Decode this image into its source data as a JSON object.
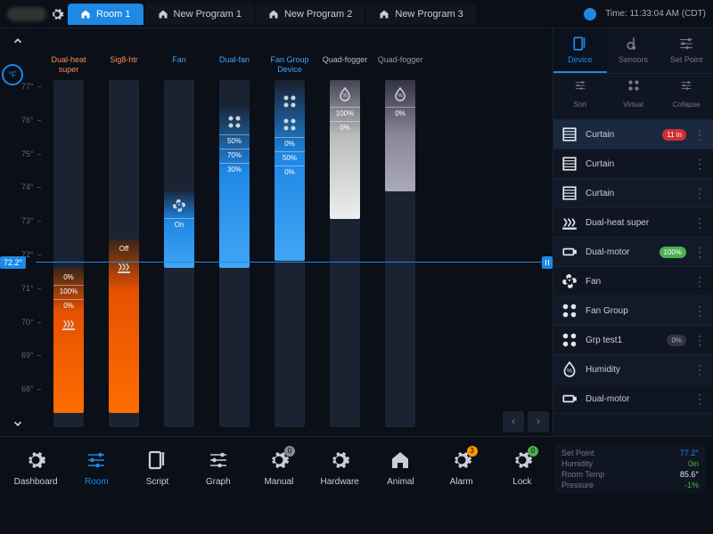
{
  "header": {
    "tabs": [
      {
        "label": "Room 1",
        "active": true
      },
      {
        "label": "New Program 1",
        "active": false
      },
      {
        "label": "New Program 2",
        "active": false
      },
      {
        "label": "New Program 3",
        "active": false
      }
    ],
    "time": "Time: 11:33:04 AM (CDT)"
  },
  "axis": {
    "unit": "°F",
    "setpoint": "72.2°",
    "ticks": [
      "77°",
      "76°",
      "75°",
      "74°",
      "73°",
      "72°",
      "71°",
      "70°",
      "69°",
      "68°"
    ]
  },
  "chart_data": {
    "type": "bar",
    "setpoint_temp": 72.2,
    "y_range": [
      67.5,
      77.5
    ],
    "columns": [
      {
        "name": "Dual-heat super",
        "group": "heat",
        "segments": [
          {
            "label": "0%"
          },
          {
            "label": "100%"
          },
          {
            "label": "0%"
          },
          {
            "icon": "heater"
          }
        ],
        "bar_top_pct": 54,
        "bar_height_pct": 42
      },
      {
        "name": "Sig8-htr",
        "group": "heat",
        "segments": [
          {
            "label": "Off"
          },
          {
            "icon": "heater"
          }
        ],
        "bar_top_pct": 46,
        "bar_height_pct": 50
      },
      {
        "name": "Fan",
        "group": "cool",
        "segments": [
          {
            "icon": "fan"
          },
          {
            "label": "On"
          }
        ],
        "bar_top_pct": 32,
        "bar_height_pct": 22
      },
      {
        "name": "Dual-fan",
        "group": "cool",
        "segments": [
          {
            "icon": "fan-group"
          },
          {
            "label": "50%"
          },
          {
            "label": "70%"
          },
          {
            "label": "30%"
          }
        ],
        "bar_top_pct": 8,
        "bar_height_pct": 46
      },
      {
        "name": "Fan Group Device",
        "group": "cool",
        "segments": [
          {
            "icon": "fan-group"
          },
          {
            "icon": "fan-group"
          },
          {
            "label": "0%"
          },
          {
            "label": "50%"
          },
          {
            "label": "0%"
          }
        ],
        "bar_top_pct": 2,
        "bar_height_pct": 50
      },
      {
        "name": "Quad-fogger",
        "group": "fog-white",
        "segments": [
          {
            "icon": "humidity"
          },
          {
            "label": "100%"
          },
          {
            "label": "0%"
          }
        ],
        "bar_top_pct": 0,
        "bar_height_pct": 40
      },
      {
        "name": "Quad-fogger",
        "group": "fog-grey",
        "segments": [
          {
            "icon": "humidity"
          },
          {
            "label": "0%"
          }
        ],
        "bar_top_pct": 0,
        "bar_height_pct": 32
      }
    ]
  },
  "side": {
    "tabs": [
      {
        "label": "Device",
        "icon": "device",
        "active": true
      },
      {
        "label": "Sensors",
        "icon": "thermometer",
        "active": false
      },
      {
        "label": "Set Point",
        "icon": "slider",
        "active": false
      }
    ],
    "controls": [
      {
        "label": "Sort",
        "icon": "sort"
      },
      {
        "label": "Virtual",
        "icon": "virtual"
      },
      {
        "label": "Collapse",
        "icon": "collapse"
      }
    ],
    "devices": [
      {
        "name": "Curtain",
        "icon": "curtain",
        "status": {
          "type": "badge-red",
          "text": "11 in"
        },
        "active": true
      },
      {
        "name": "Curtain",
        "icon": "curtain",
        "status": {
          "type": "dot-red"
        }
      },
      {
        "name": "Curtain",
        "icon": "curtain",
        "status": {
          "type": "dot-green"
        }
      },
      {
        "name": "Dual-heat super",
        "icon": "heater",
        "status": {
          "type": "dot-green"
        }
      },
      {
        "name": "Dual-motor",
        "icon": "motor",
        "status": {
          "type": "badge-green",
          "text": "100%"
        }
      },
      {
        "name": "Fan",
        "icon": "fan",
        "status": {
          "type": "dot-grey"
        }
      },
      {
        "name": "Fan Group",
        "icon": "fan-group",
        "status": {
          "type": "dot-grey"
        }
      },
      {
        "name": "Grp test1",
        "icon": "fan-group",
        "status": {
          "type": "badge",
          "text": "0%"
        }
      },
      {
        "name": "Humidity",
        "icon": "humidity",
        "status": {
          "type": "dot-grey"
        }
      },
      {
        "name": "Dual-motor",
        "icon": "motor",
        "status": {
          "type": "dot-grey"
        }
      }
    ]
  },
  "bottom_nav": [
    {
      "label": "Dashboard",
      "icon": "dashboard"
    },
    {
      "label": "Room",
      "icon": "room",
      "active": true
    },
    {
      "label": "Script",
      "icon": "script"
    },
    {
      "label": "Graph",
      "icon": "graph"
    },
    {
      "label": "Manual",
      "icon": "manual",
      "badge": {
        "text": "0",
        "color": "#888"
      }
    },
    {
      "label": "Hardware",
      "icon": "hardware"
    },
    {
      "label": "Animal",
      "icon": "animal"
    },
    {
      "label": "Alarm",
      "icon": "alarm",
      "badge": {
        "text": "3",
        "color": "#ff9800"
      }
    },
    {
      "label": "Lock",
      "icon": "lock",
      "badge": {
        "text": "0",
        "color": "#4caf50"
      }
    }
  ],
  "status": {
    "setpoint_label": "Set Point",
    "setpoint_val": "77.2°",
    "roomtemp_label": "Room Temp",
    "roomtemp_val": "85.6°",
    "humidity_label": "Humidity",
    "humidity_val": "0in",
    "pressure_label": "Pressure",
    "pressure_val": "-1%"
  }
}
